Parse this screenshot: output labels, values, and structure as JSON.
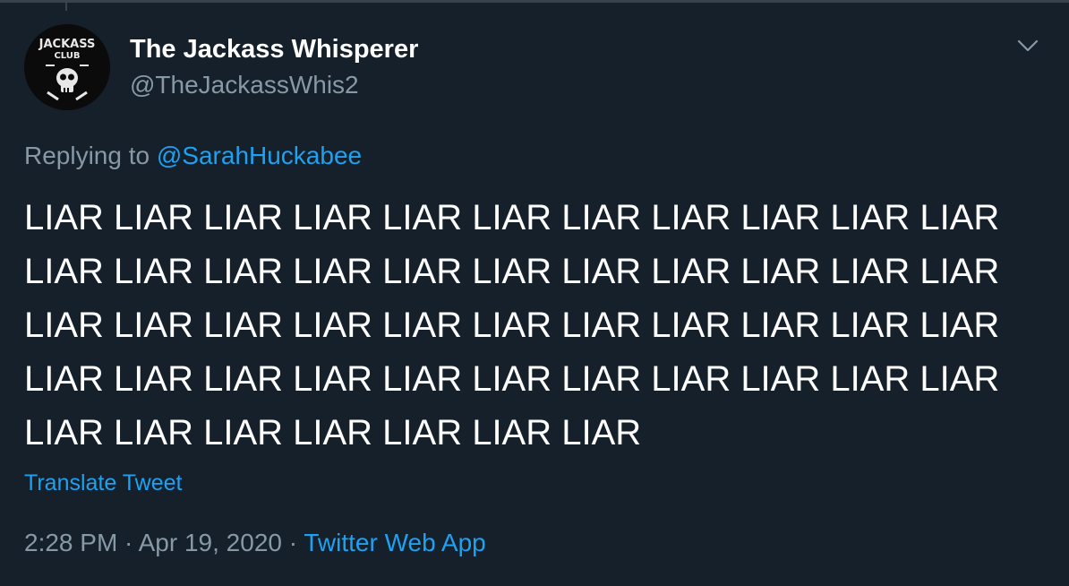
{
  "tweet": {
    "author_name": "The Jackass Whisperer",
    "author_handle": "@TheJackassWhis2",
    "avatar_text_top": "JACKASS",
    "avatar_text_bottom": "CLUB",
    "replying_prefix": "Replying to ",
    "replying_to": "@SarahHuckabee",
    "body": "LIAR LIAR LIAR LIAR LIAR LIAR LIAR LIAR LIAR LIAR LIAR LIAR LIAR LIAR LIAR LIAR LIAR LIAR LIAR LIAR LIAR LIAR LIAR LIAR LIAR LIAR LIAR LIAR LIAR LIAR LIAR LIAR LIAR LIAR LIAR LIAR LIAR LIAR LIAR LIAR LIAR LIAR LIAR LIAR LIAR LIAR LIAR LIAR LIAR LIAR LIAR",
    "translate_label": "Translate Tweet",
    "time": "2:28 PM",
    "separator": " · ",
    "date": "Apr 19, 2020",
    "source": "Twitter Web App"
  },
  "icons": {
    "more": "chevron-down-icon"
  },
  "colors": {
    "background": "#15202b",
    "primary_text": "#ffffff",
    "secondary_text": "#8899a6",
    "accent": "#1da1f2",
    "border": "#38444d"
  }
}
